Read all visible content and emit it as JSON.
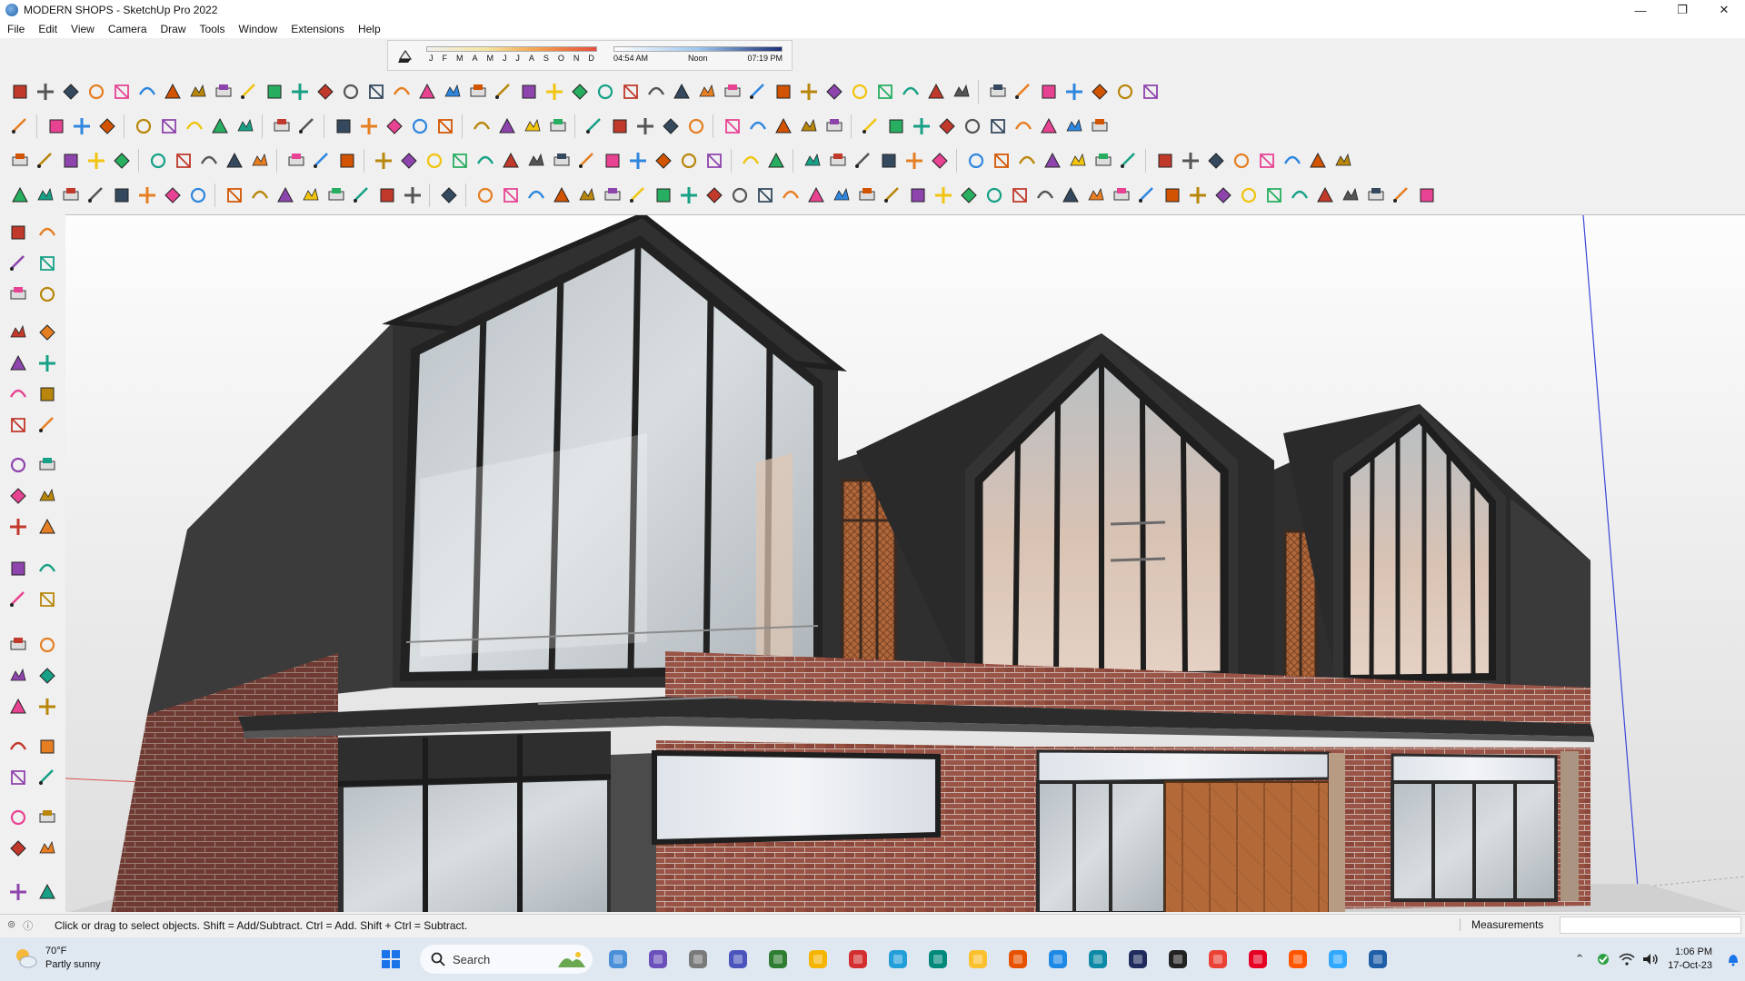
{
  "window": {
    "title": "MODERN SHOPS - SketchUp Pro 2022",
    "minimize_glyph": "—",
    "maximize_glyph": "❐",
    "close_glyph": "✕"
  },
  "menu": [
    "File",
    "Edit",
    "View",
    "Camera",
    "Draw",
    "Tools",
    "Window",
    "Extensions",
    "Help"
  ],
  "shadows": {
    "months": [
      "J",
      "F",
      "M",
      "A",
      "M",
      "J",
      "J",
      "A",
      "S",
      "O",
      "N",
      "D"
    ],
    "time_start": "04:54 AM",
    "time_mid": "Noon",
    "time_end": "07:19 PM"
  },
  "status": {
    "hint": "Click or drag to select objects. Shift = Add/Subtract. Ctrl = Add. Shift + Ctrl = Subtract.",
    "measurements_label": "Measurements"
  },
  "taskbar": {
    "weather_temp": "70°F",
    "weather_desc": "Partly sunny",
    "search_label": "Search",
    "time": "1:06 PM",
    "date": "17-Oct-23"
  },
  "colors": {
    "brick": "#8c4a3e",
    "dark_frame": "#2e2e2e",
    "glass": "#c9cfd3",
    "timber": "#b0673a",
    "accent_blue": "#1f5fa8"
  }
}
